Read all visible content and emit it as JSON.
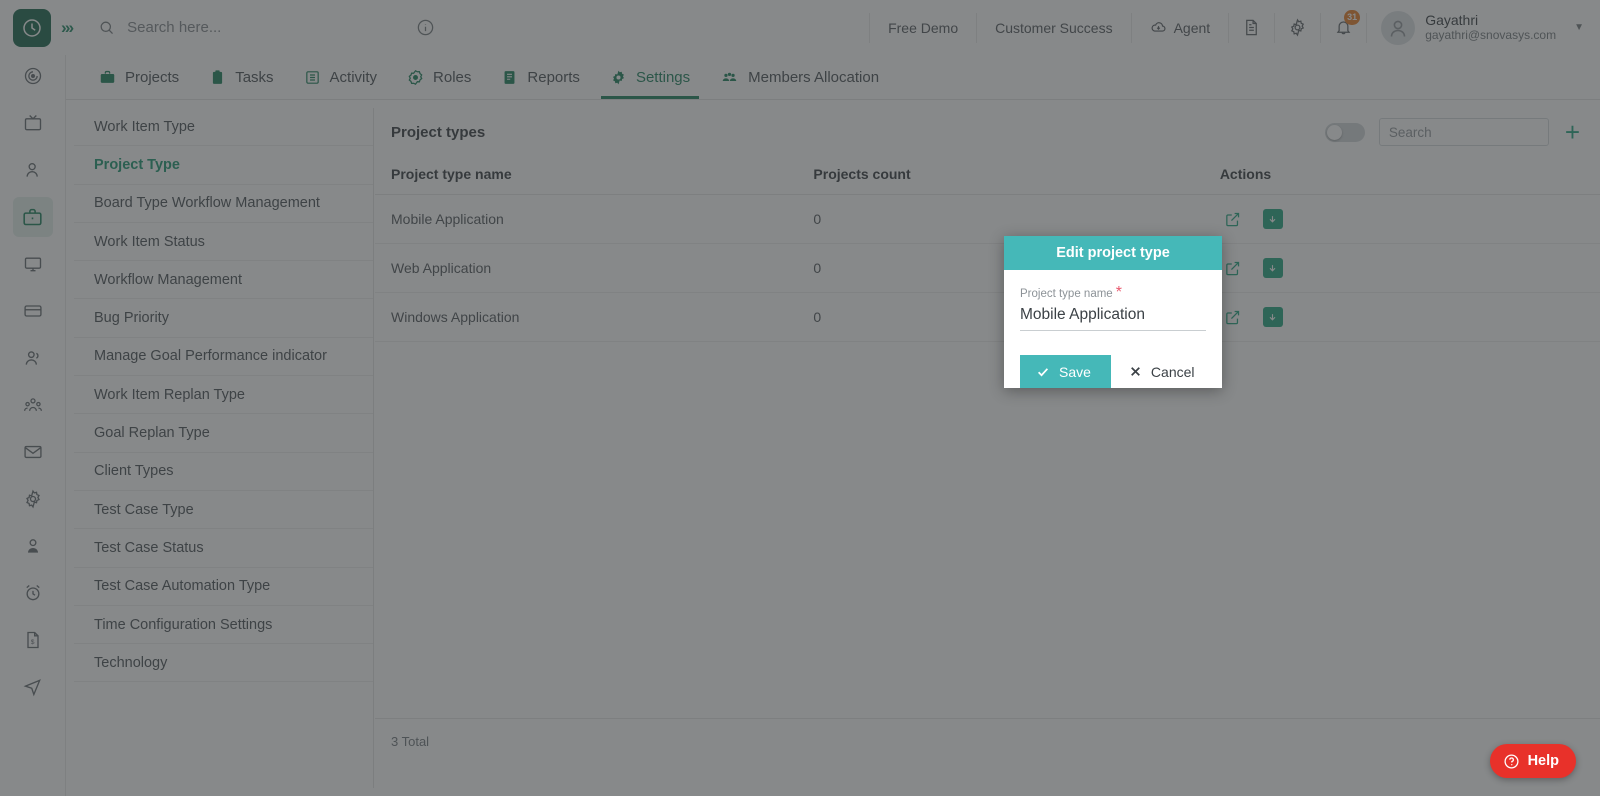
{
  "topbar": {
    "logo_icon": "clock-logo-icon",
    "expand_icon": "chevrons-right-icon",
    "search_placeholder": "Search here...",
    "search_value": "",
    "info_icon": "info-circle-icon",
    "chips": [
      {
        "label": "Free Demo",
        "icon": null
      },
      {
        "label": "Customer Success",
        "icon": null
      },
      {
        "label": "Agent",
        "icon": "cloud-icon"
      }
    ],
    "icons": [
      {
        "name": "document-icon"
      },
      {
        "name": "gear-icon"
      },
      {
        "name": "bell-icon",
        "badge": "31"
      }
    ],
    "user": {
      "name": "Gayathri",
      "email": "gayathri@snovasys.com",
      "avatar_icon": "user-avatar-icon",
      "caret_icon": "chevron-down-icon"
    }
  },
  "rail": [
    {
      "name": "target-icon",
      "active": false
    },
    {
      "name": "tv-icon",
      "active": false
    },
    {
      "name": "person-icon",
      "active": false
    },
    {
      "name": "briefcase-icon",
      "active": true
    },
    {
      "name": "monitor-icon",
      "active": false
    },
    {
      "name": "card-icon",
      "active": false
    },
    {
      "name": "users-icon",
      "active": false
    },
    {
      "name": "group-icon",
      "active": false
    },
    {
      "name": "mail-icon",
      "active": false
    },
    {
      "name": "gear-icon",
      "active": false
    },
    {
      "name": "contact-icon",
      "active": false
    },
    {
      "name": "alarm-clock-icon",
      "active": false
    },
    {
      "name": "invoice-icon",
      "active": false
    },
    {
      "name": "send-icon",
      "active": false
    }
  ],
  "nav_tabs": [
    {
      "label": "Projects",
      "icon": "briefcase-icon",
      "active": false
    },
    {
      "label": "Tasks",
      "icon": "clipboard-icon",
      "active": false
    },
    {
      "label": "Activity",
      "icon": "list-icon",
      "active": false
    },
    {
      "label": "Roles",
      "icon": "badge-icon",
      "active": false
    },
    {
      "label": "Reports",
      "icon": "report-icon",
      "active": false
    },
    {
      "label": "Settings",
      "icon": "gear-icon",
      "active": true
    },
    {
      "label": "Members Allocation",
      "icon": "members-icon",
      "active": false
    }
  ],
  "settings_menu": [
    {
      "label": "Work Item Type",
      "active": false
    },
    {
      "label": "Project Type",
      "active": true
    },
    {
      "label": "Board Type Workflow Management",
      "active": false
    },
    {
      "label": "Work Item Status",
      "active": false
    },
    {
      "label": "Workflow Management",
      "active": false
    },
    {
      "label": "Bug Priority",
      "active": false
    },
    {
      "label": "Manage Goal Performance indicator",
      "active": false
    },
    {
      "label": "Work Item Replan Type",
      "active": false
    },
    {
      "label": "Goal Replan Type",
      "active": false
    },
    {
      "label": "Client Types",
      "active": false
    },
    {
      "label": "Test Case Type",
      "active": false
    },
    {
      "label": "Test Case Status",
      "active": false
    },
    {
      "label": "Test Case Automation Type",
      "active": false
    },
    {
      "label": "Time Configuration Settings",
      "active": false
    },
    {
      "label": "Technology",
      "active": false
    }
  ],
  "panel": {
    "title": "Project types",
    "toggle_on": false,
    "search_placeholder": "Search",
    "search_value": "",
    "add_label": "+",
    "columns": [
      "Project type name",
      "Projects count",
      "Actions"
    ],
    "rows": [
      {
        "name": "Mobile Application",
        "count": "0"
      },
      {
        "name": "Web Application",
        "count": "0"
      },
      {
        "name": "Windows Application",
        "count": "0"
      }
    ],
    "total_text": "3 Total"
  },
  "modal": {
    "title": "Edit project type",
    "field_label": "Project type name",
    "field_required": "*",
    "field_value": "Mobile Application",
    "field_placeholder": "",
    "save_label": "Save",
    "cancel_label": "Cancel",
    "check_icon": "check-icon",
    "close_icon": "close-x-icon"
  },
  "help": {
    "label": "Help",
    "icon": "question-circle-icon"
  },
  "colors": {
    "brand_green": "#0f7a52",
    "accent_green": "#17a07a",
    "modal_teal": "#45b8b8",
    "help_red": "#e8312a",
    "badge_orange": "#e8761b"
  }
}
